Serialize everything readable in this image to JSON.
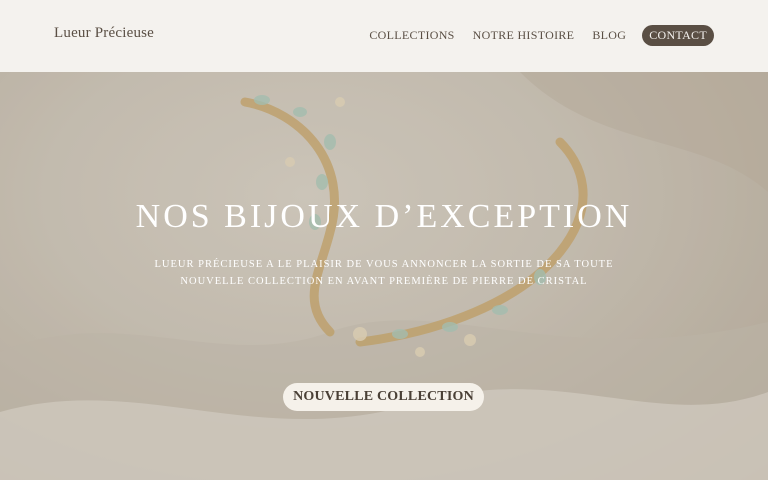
{
  "header": {
    "logo": "Lueur Précieuse",
    "nav": [
      {
        "label": "COLLECTIONS"
      },
      {
        "label": "NOTRE HISTOIRE"
      },
      {
        "label": "BLOG"
      },
      {
        "label": "CONTACT"
      }
    ]
  },
  "hero": {
    "title": "NOS BIJOUX D’EXCEPTION",
    "subtitle_lines": [
      "LUEUR PRÉCIEUSE A LE PLAISIR DE VOUS ANNONCER LA SORTIE DE SA TOUTE",
      "NOUVELLE COLLECTION EN AVANT PREMIÈRE DE PIERRE DE CRISTAL"
    ],
    "cta_label": "NOUVELLE COLLECTION"
  }
}
